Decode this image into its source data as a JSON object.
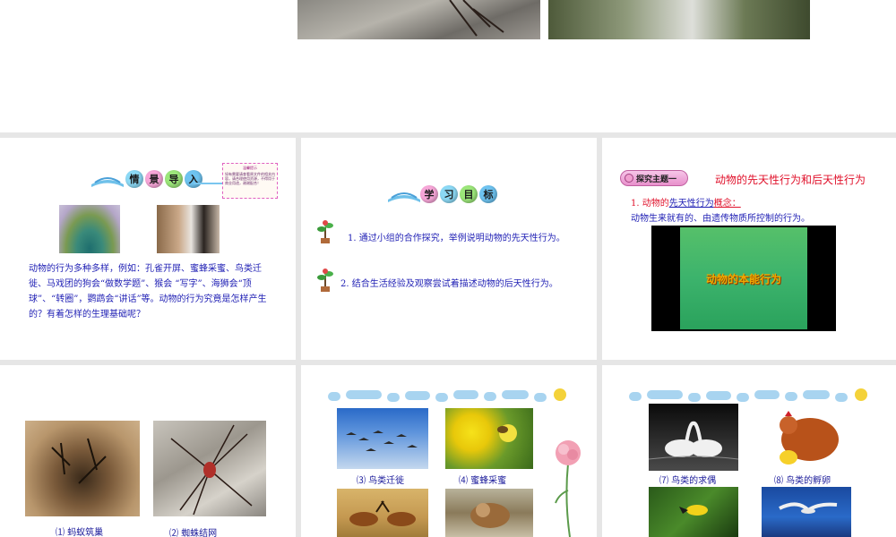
{
  "top_strip": {},
  "slide_intro": {
    "header_chars": [
      "情",
      "景",
      "导",
      "入"
    ],
    "note_title": "温馨提示",
    "note_text": "如有需要请查看原文件的相关内容，请合理使用资源，不得用于商业用途，谢谢配合！",
    "body": "动物的行为多种多样，例如：孔雀开屏、蜜蜂采蜜、鸟类迁徙、马戏团的狗会“做数学题”、猴会 “写字”、海狮会“顶球”、“转圈”，鹦鹉会“讲话”等。动物的行为究竟是怎样产生的？有着怎样的生理基础呢？"
  },
  "slide_goals": {
    "header_chars": [
      "学",
      "习",
      "目",
      "标"
    ],
    "goals": [
      "1. 通过小组的合作探究，举例说明动物的先天性行为。",
      "2. 结合生活经验及观察尝试着描述动物的后天性行为。"
    ]
  },
  "slide_topic": {
    "badge": "探究主题一",
    "title": "动物的先天性行为和后天性行为",
    "point_prefix": "1. 动物的",
    "point_link": "先天性行为",
    "point_suffix": "概念：",
    "definition": "动物生来就有的、由遗传物质所控制的行为。",
    "video_title": "动物的本能行为"
  },
  "slide_ants": {
    "captions": [
      "⑴ 蚂蚁筑巢",
      "⑵ 蜘蛛结网"
    ]
  },
  "slide_birds": {
    "captions": [
      "⑶ 鸟类迁徙",
      "⑷ 蜜蜂采蜜"
    ]
  },
  "slide_courtship": {
    "captions": [
      "⑺ 鸟类的求偶",
      "⑻ 鸟类的孵卵"
    ]
  },
  "colors": {
    "text_blue": "#1f1fb4",
    "title_red": "#e0102a",
    "video_green": "#3cb36c",
    "video_title": "#f0a800"
  }
}
